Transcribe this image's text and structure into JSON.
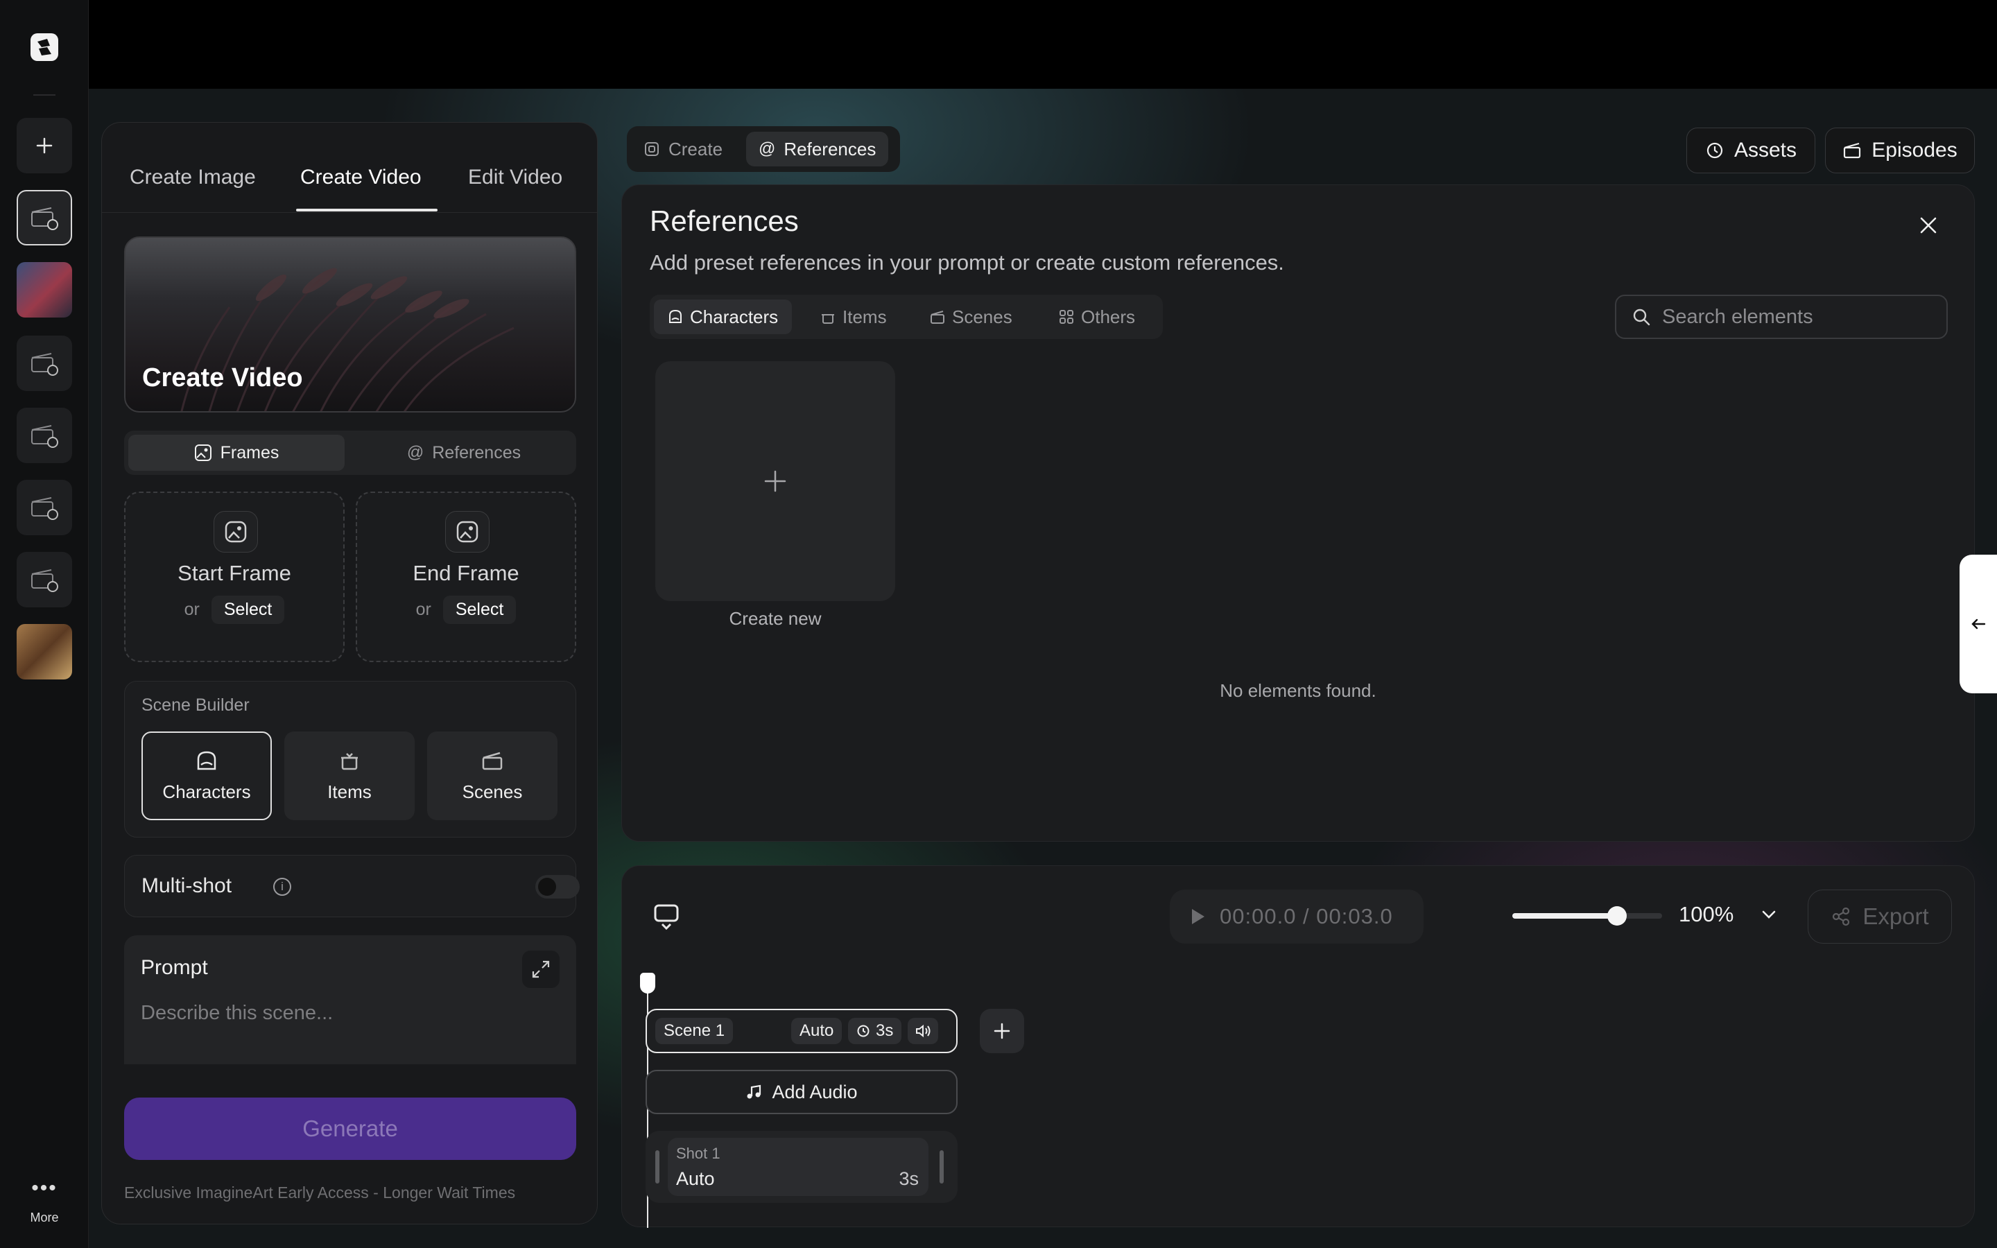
{
  "rail": {
    "more_label": "More"
  },
  "left_panel": {
    "tabs": [
      "Create Image",
      "Create Video",
      "Edit Video"
    ],
    "active_tab": "Create Video",
    "hero_title": "Create Video",
    "segments": [
      "Frames",
      "References"
    ],
    "start_frame": {
      "title": "Start Frame",
      "or": "or",
      "select": "Select"
    },
    "end_frame": {
      "title": "End Frame",
      "or": "or",
      "select": "Select"
    },
    "scene_builder": {
      "label": "Scene Builder",
      "items": [
        "Characters",
        "Items",
        "Scenes"
      ]
    },
    "multishot_label": "Multi-shot",
    "multishot_enabled": false,
    "prompt": {
      "title": "Prompt",
      "placeholder": "Describe this scene..."
    },
    "generate_label": "Generate",
    "footer_note": "Exclusive ImagineArt Early Access - Longer Wait Times"
  },
  "mode_tabs": [
    "Create",
    "References"
  ],
  "active_mode": "References",
  "header_buttons": {
    "assets": "Assets",
    "episodes": "Episodes"
  },
  "references": {
    "title": "References",
    "subtitle": "Add preset references in your prompt or create custom references.",
    "tabs": [
      "Characters",
      "Items",
      "Scenes",
      "Others"
    ],
    "active_tab": "Characters",
    "search_placeholder": "Search elements",
    "create_new_label": "Create new",
    "empty_text": "No elements found."
  },
  "timeline": {
    "time": "00:00.0 / 00:03.0",
    "volume_level": 0.7,
    "zoom": "100%",
    "export_label": "Export",
    "scene": {
      "name": "Scene 1",
      "mode": "Auto",
      "duration": "3s"
    },
    "add_audio_label": "Add Audio",
    "shot": {
      "name": "Shot 1",
      "mode": "Auto",
      "duration": "3s"
    }
  },
  "colors": {
    "accent_purple": "#4a2d8d",
    "panel_bg": "#1b1c1e",
    "rail_bg": "#101112"
  }
}
